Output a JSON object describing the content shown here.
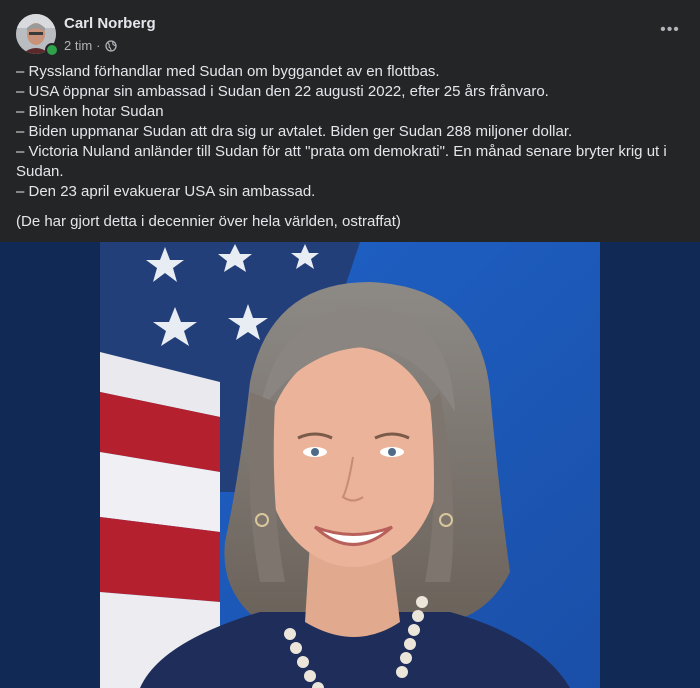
{
  "post": {
    "author": "Carl Norberg",
    "time": "2 tim",
    "separator": "·",
    "privacy_icon": "globe-icon",
    "more_icon": "more-options-icon",
    "more_label": "•••",
    "lines": [
      "– Ryssland förhandlar med Sudan om byggandet av en flottbas.",
      "– USA öppnar sin ambassad i Sudan den 22 augusti 2022, efter 25 års frånvaro.",
      "– Blinken hotar Sudan",
      "– Biden uppmanar Sudan att dra sig ur avtalet. Biden ger Sudan 288 miljoner dollar.",
      "– Victoria Nuland anländer till Sudan för att \"prata om demokrati\". En månad senare bryter krig ut i",
      "Sudan.",
      "– Den 23 april evakuerar USA sin ambassad."
    ],
    "note": "(De har gjort detta i decennier över hela världen, ostraffat)"
  },
  "colors": {
    "background": "#242526",
    "text": "#e4e6eb",
    "secondary_text": "#b0b3b8",
    "online": "#31a24c",
    "media_background": "#102a55"
  }
}
